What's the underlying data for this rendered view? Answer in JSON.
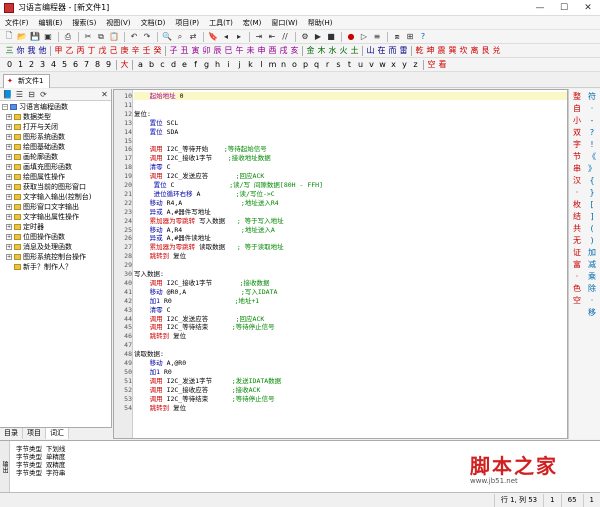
{
  "window": {
    "title": "习语言编程器 - [新文件1]"
  },
  "menu": [
    "文件(F)",
    "编辑(E)",
    "搜索(S)",
    "视图(V)",
    "文档(D)",
    "项目(P)",
    "工具(T)",
    "宏(M)",
    "窗口(W)",
    "帮助(H)"
  ],
  "charbar1": [
    {
      "t": "三",
      "c": "grn"
    },
    {
      "t": "你",
      "c": "blu"
    },
    {
      "t": "我",
      "c": "blu"
    },
    {
      "t": "他",
      "c": "blu"
    },
    {
      "t": "|",
      "c": "sep"
    },
    {
      "t": "甲",
      "c": "red"
    },
    {
      "t": "乙",
      "c": "red"
    },
    {
      "t": "丙",
      "c": "red"
    },
    {
      "t": "丁",
      "c": "red"
    },
    {
      "t": "戊",
      "c": "red"
    },
    {
      "t": "己",
      "c": "red"
    },
    {
      "t": "庚",
      "c": "red"
    },
    {
      "t": "辛",
      "c": "red"
    },
    {
      "t": "壬",
      "c": "red"
    },
    {
      "t": "癸",
      "c": "red"
    },
    {
      "t": "|",
      "c": "sep"
    },
    {
      "t": "子",
      "c": "mag"
    },
    {
      "t": "丑",
      "c": "mag"
    },
    {
      "t": "寅",
      "c": "mag"
    },
    {
      "t": "卯",
      "c": "mag"
    },
    {
      "t": "辰",
      "c": "mag"
    },
    {
      "t": "巳",
      "c": "mag"
    },
    {
      "t": "午",
      "c": "mag"
    },
    {
      "t": "未",
      "c": "mag"
    },
    {
      "t": "申",
      "c": "mag"
    },
    {
      "t": "酉",
      "c": "mag"
    },
    {
      "t": "戌",
      "c": "mag"
    },
    {
      "t": "亥",
      "c": "mag"
    },
    {
      "t": "|",
      "c": "sep"
    },
    {
      "t": "金",
      "c": "grn"
    },
    {
      "t": "木",
      "c": "grn"
    },
    {
      "t": "水",
      "c": "grn"
    },
    {
      "t": "火",
      "c": "grn"
    },
    {
      "t": "土",
      "c": "grn"
    },
    {
      "t": "|",
      "c": "sep"
    },
    {
      "t": "山",
      "c": "blu"
    },
    {
      "t": "在",
      "c": "blu"
    },
    {
      "t": "而",
      "c": "blu"
    },
    {
      "t": "雷",
      "c": "blu"
    },
    {
      "t": "|",
      "c": "sep"
    },
    {
      "t": "乾",
      "c": "red"
    },
    {
      "t": "坤",
      "c": "red"
    },
    {
      "t": "震",
      "c": "red"
    },
    {
      "t": "巽",
      "c": "red"
    },
    {
      "t": "坎",
      "c": "red"
    },
    {
      "t": "离",
      "c": "red"
    },
    {
      "t": "艮",
      "c": "red"
    },
    {
      "t": "兑",
      "c": "red"
    }
  ],
  "charbar2": [
    {
      "t": "0",
      "c": ""
    },
    {
      "t": "1",
      "c": ""
    },
    {
      "t": "2",
      "c": ""
    },
    {
      "t": "3",
      "c": ""
    },
    {
      "t": "4",
      "c": ""
    },
    {
      "t": "5",
      "c": ""
    },
    {
      "t": "6",
      "c": ""
    },
    {
      "t": "7",
      "c": ""
    },
    {
      "t": "8",
      "c": ""
    },
    {
      "t": "9",
      "c": ""
    },
    {
      "t": "|",
      "c": "sep"
    },
    {
      "t": "大",
      "c": "red"
    },
    {
      "t": "|",
      "c": "sep"
    },
    {
      "t": "a",
      "c": ""
    },
    {
      "t": "b",
      "c": ""
    },
    {
      "t": "c",
      "c": ""
    },
    {
      "t": "d",
      "c": ""
    },
    {
      "t": "e",
      "c": ""
    },
    {
      "t": "f",
      "c": ""
    },
    {
      "t": "g",
      "c": ""
    },
    {
      "t": "h",
      "c": ""
    },
    {
      "t": "i",
      "c": ""
    },
    {
      "t": "j",
      "c": ""
    },
    {
      "t": "k",
      "c": ""
    },
    {
      "t": "l",
      "c": ""
    },
    {
      "t": "m",
      "c": ""
    },
    {
      "t": "n",
      "c": ""
    },
    {
      "t": "o",
      "c": ""
    },
    {
      "t": "p",
      "c": ""
    },
    {
      "t": "q",
      "c": ""
    },
    {
      "t": "r",
      "c": ""
    },
    {
      "t": "s",
      "c": ""
    },
    {
      "t": "t",
      "c": ""
    },
    {
      "t": "u",
      "c": ""
    },
    {
      "t": "v",
      "c": ""
    },
    {
      "t": "w",
      "c": ""
    },
    {
      "t": "x",
      "c": ""
    },
    {
      "t": "y",
      "c": ""
    },
    {
      "t": "z",
      "c": ""
    },
    {
      "t": "|",
      "c": "sep"
    },
    {
      "t": "空",
      "c": "red"
    },
    {
      "t": "看",
      "c": "red"
    }
  ],
  "doctab": {
    "label": "新文件1"
  },
  "tree": {
    "root": "习语言编程函数",
    "items": [
      "数据类型",
      "打开与关闭",
      "图形系统函数",
      "绘图基础函数",
      "画轮廓函数",
      "画填充图形函数",
      "绘图属性操作",
      "获取当前的图形窗口",
      "文字输入输出(控制台)",
      "图形窗口文字输出",
      "文字输出属性操作",
      "定时器",
      "位图操作函数",
      "消息及处理函数",
      "图形系统控制台操作",
      "新手？制作人？"
    ]
  },
  "left_tabs": [
    "目录",
    "项目",
    "词汇"
  ],
  "code": [
    {
      "n": "10",
      "parts": [
        {
          "c": "fn",
          "t": "    起始地址"
        },
        {
          "c": "",
          "t": " 0"
        }
      ],
      "hl": true
    },
    {
      "n": "11",
      "parts": [
        {
          "c": "",
          "t": ""
        }
      ]
    },
    {
      "n": "12",
      "parts": [
        {
          "c": "",
          "t": "复位:"
        }
      ]
    },
    {
      "n": "13",
      "parts": [
        {
          "c": "kw",
          "t": "    置位"
        },
        {
          "c": "",
          "t": " SCL"
        }
      ]
    },
    {
      "n": "14",
      "parts": [
        {
          "c": "kw",
          "t": "    置位"
        },
        {
          "c": "",
          "t": " SDA"
        }
      ]
    },
    {
      "n": "15",
      "parts": [
        {
          "c": "",
          "t": ""
        }
      ]
    },
    {
      "n": "16",
      "parts": [
        {
          "c": "rd",
          "t": "    调用"
        },
        {
          "c": "",
          "t": " I2C_等待开始"
        },
        {
          "c": "cm",
          "t": "    ;等待起始信号"
        }
      ]
    },
    {
      "n": "17",
      "parts": [
        {
          "c": "rd",
          "t": "    调用"
        },
        {
          "c": "",
          "t": " I2C_接收1字节"
        },
        {
          "c": "cm",
          "t": "    ;接收地址数据"
        }
      ]
    },
    {
      "n": "18",
      "parts": [
        {
          "c": "kw",
          "t": "    清零"
        },
        {
          "c": "",
          "t": " C"
        }
      ]
    },
    {
      "n": "19",
      "parts": [
        {
          "c": "rd",
          "t": "    调用"
        },
        {
          "c": "",
          "t": " I2C_发送应答"
        },
        {
          "c": "cm",
          "t": "       ;回应ACK"
        }
      ]
    },
    {
      "n": "20",
      "parts": [
        {
          "c": "kw",
          "t": "     置位"
        },
        {
          "c": "",
          "t": " C"
        },
        {
          "c": "cm",
          "t": "              ;读/写 间隙数据[80H - FFH]"
        }
      ]
    },
    {
      "n": "21",
      "parts": [
        {
          "c": "kw",
          "t": "     进位循环右移"
        },
        {
          "c": "",
          "t": " A"
        },
        {
          "c": "cm",
          "t": "         ;读/写位->C"
        }
      ]
    },
    {
      "n": "22",
      "parts": [
        {
          "c": "kw",
          "t": "    移动"
        },
        {
          "c": "",
          "t": " R4,A"
        },
        {
          "c": "cm",
          "t": "               ;地址送入R4"
        }
      ]
    },
    {
      "n": "23",
      "parts": [
        {
          "c": "kw",
          "t": "    异或"
        },
        {
          "c": "",
          "t": " A,#器件写地址"
        }
      ]
    },
    {
      "n": "24",
      "parts": [
        {
          "c": "rd",
          "t": "    累加器为零跳转"
        },
        {
          "c": "",
          "t": " 写入数据"
        },
        {
          "c": "cm",
          "t": "   ; 等于写入地址"
        }
      ]
    },
    {
      "n": "25",
      "parts": [
        {
          "c": "kw",
          "t": "    移动"
        },
        {
          "c": "",
          "t": " A,R4"
        },
        {
          "c": "cm",
          "t": "               ;地址送入A"
        }
      ]
    },
    {
      "n": "26",
      "parts": [
        {
          "c": "kw",
          "t": "    异或"
        },
        {
          "c": "",
          "t": " A,#器件读地址"
        }
      ]
    },
    {
      "n": "27",
      "parts": [
        {
          "c": "rd",
          "t": "    累加器为零跳转"
        },
        {
          "c": "",
          "t": " 读取数据"
        },
        {
          "c": "cm",
          "t": "   ; 等于读取地址"
        }
      ]
    },
    {
      "n": "28",
      "parts": [
        {
          "c": "rd",
          "t": "    跳转到"
        },
        {
          "c": "",
          "t": " 复位"
        }
      ]
    },
    {
      "n": "29",
      "parts": [
        {
          "c": "",
          "t": ""
        }
      ]
    },
    {
      "n": "30",
      "parts": [
        {
          "c": "",
          "t": "写入数据:"
        }
      ]
    },
    {
      "n": "40",
      "parts": [
        {
          "c": "rd",
          "t": "    调用"
        },
        {
          "c": "",
          "t": " I2C_接收1字节"
        },
        {
          "c": "cm",
          "t": "       ;接收数据"
        }
      ]
    },
    {
      "n": "41",
      "parts": [
        {
          "c": "kw",
          "t": "    移动"
        },
        {
          "c": "",
          "t": " @R0,A"
        },
        {
          "c": "cm",
          "t": "              ;写入IDATA"
        }
      ]
    },
    {
      "n": "42",
      "parts": [
        {
          "c": "kw",
          "t": "    加1"
        },
        {
          "c": "",
          "t": " R0"
        },
        {
          "c": "cm",
          "t": "                ;地址+1"
        }
      ]
    },
    {
      "n": "43",
      "parts": [
        {
          "c": "kw",
          "t": "    清零"
        },
        {
          "c": "",
          "t": " C"
        }
      ]
    },
    {
      "n": "44",
      "parts": [
        {
          "c": "rd",
          "t": "    调用"
        },
        {
          "c": "",
          "t": " I2C_发送应答"
        },
        {
          "c": "cm",
          "t": "       ;回应ACK"
        }
      ]
    },
    {
      "n": "45",
      "parts": [
        {
          "c": "rd",
          "t": "    调用"
        },
        {
          "c": "",
          "t": " I2C_等待结束"
        },
        {
          "c": "cm",
          "t": "      ;等待停止信号"
        }
      ]
    },
    {
      "n": "46",
      "parts": [
        {
          "c": "rd",
          "t": "    跳转到"
        },
        {
          "c": "",
          "t": " 复位"
        }
      ]
    },
    {
      "n": "47",
      "parts": [
        {
          "c": "",
          "t": ""
        }
      ]
    },
    {
      "n": "48",
      "parts": [
        {
          "c": "",
          "t": "读取数据:"
        }
      ]
    },
    {
      "n": "49",
      "parts": [
        {
          "c": "kw",
          "t": "    移动"
        },
        {
          "c": "",
          "t": " A,@R0"
        }
      ]
    },
    {
      "n": "50",
      "parts": [
        {
          "c": "kw",
          "t": "    加1"
        },
        {
          "c": "",
          "t": " R0"
        }
      ]
    },
    {
      "n": "51",
      "parts": [
        {
          "c": "rd",
          "t": "    调用"
        },
        {
          "c": "",
          "t": " I2C_发送1字节"
        },
        {
          "c": "cm",
          "t": "     ;发送IDATA数据"
        }
      ]
    },
    {
      "n": "52",
      "parts": [
        {
          "c": "rd",
          "t": "    调用"
        },
        {
          "c": "",
          "t": " I2C_接收应答"
        },
        {
          "c": "cm",
          "t": "      ;接收ACK"
        }
      ]
    },
    {
      "n": "53",
      "parts": [
        {
          "c": "rd",
          "t": "    调用"
        },
        {
          "c": "",
          "t": " I2C_等待结束"
        },
        {
          "c": "cm",
          "t": "      ;等待停止信号"
        }
      ]
    },
    {
      "n": "54",
      "parts": [
        {
          "c": "rd",
          "t": "    跳转到"
        },
        {
          "c": "",
          "t": " 复位"
        }
      ]
    }
  ],
  "right_col1": [
    "整",
    "自",
    "小",
    "双",
    "字",
    "节",
    "串",
    "汉",
    "·",
    "枚",
    "结",
    "共",
    "无",
    "证",
    "富",
    "·",
    "色",
    "空"
  ],
  "right_col2": [
    "符",
    "·",
    "-",
    "?",
    "!",
    "《",
    "》",
    "{",
    "}",
    "[",
    "]",
    "(",
    ")",
    "加",
    "减",
    "乘",
    "除",
    "·",
    "移"
  ],
  "output": {
    "side_label": "输出",
    "lines": [
      "字节类型  下划线",
      "字节类型  单精度",
      "字节类型  双精度",
      "字节类型  字符串"
    ]
  },
  "status": {
    "pos": "行 1, 列 53",
    "col2": "1",
    "col3": "65",
    "col4": "1"
  },
  "watermark": {
    "main": "脚本之家",
    "sub": "www.jb51.net"
  }
}
